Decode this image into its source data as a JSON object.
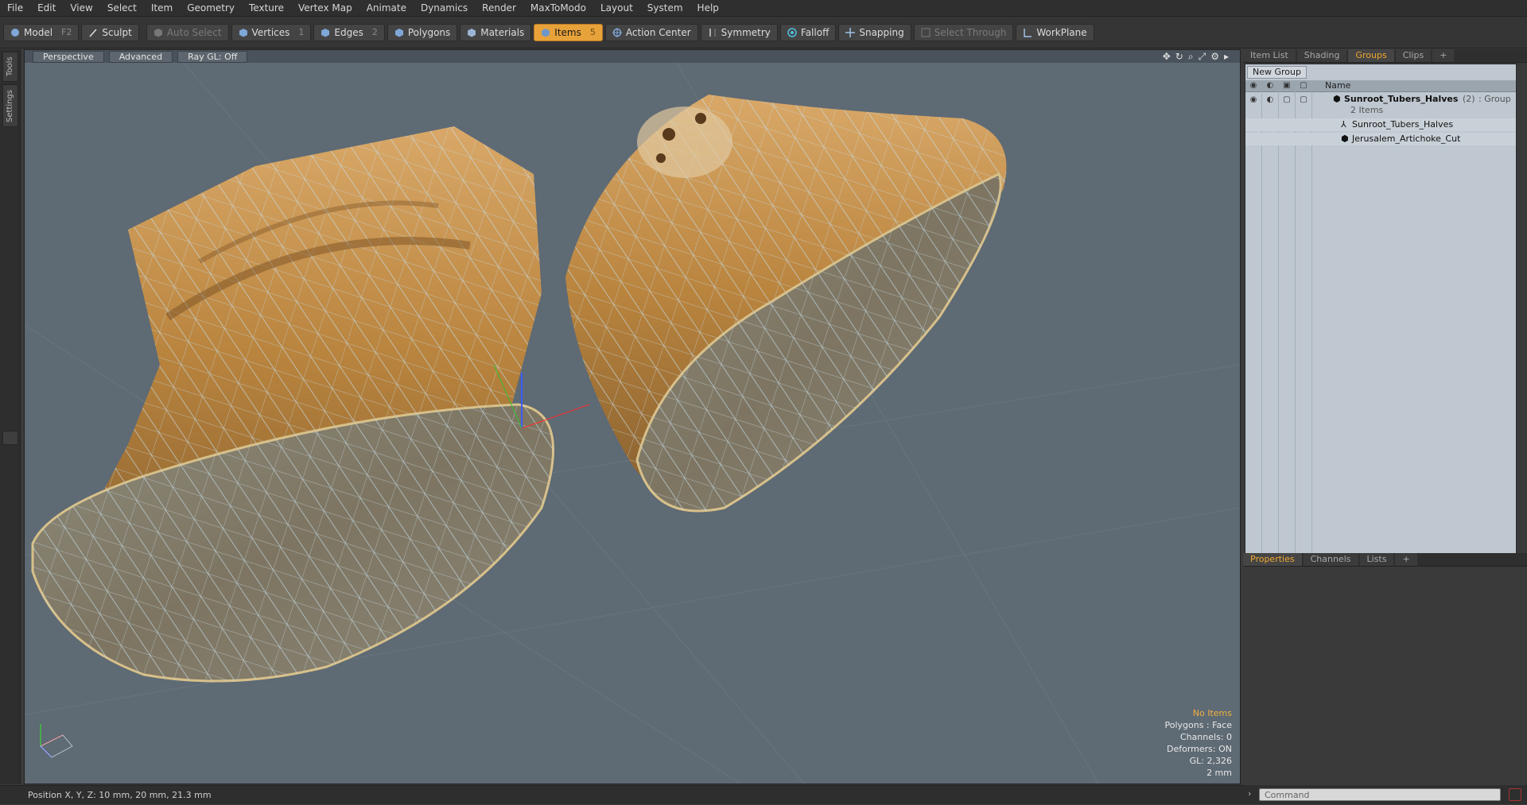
{
  "menu": [
    "File",
    "Edit",
    "View",
    "Select",
    "Item",
    "Geometry",
    "Texture",
    "Vertex Map",
    "Animate",
    "Dynamics",
    "Render",
    "MaxToModo",
    "Layout",
    "System",
    "Help"
  ],
  "toolbar": {
    "model": {
      "label": "Model",
      "key": "F2"
    },
    "sculpt": {
      "label": "Sculpt"
    },
    "auto_select": {
      "label": "Auto Select"
    },
    "vertices": {
      "label": "Vertices",
      "key": "1"
    },
    "edges": {
      "label": "Edges",
      "key": "2"
    },
    "polygons": {
      "label": "Polygons"
    },
    "materials": {
      "label": "Materials"
    },
    "items": {
      "label": "Items",
      "key": "5"
    },
    "action_center": {
      "label": "Action Center"
    },
    "symmetry": {
      "label": "Symmetry"
    },
    "falloff": {
      "label": "Falloff"
    },
    "snapping": {
      "label": "Snapping"
    },
    "select_through": {
      "label": "Select Through"
    },
    "workplane": {
      "label": "WorkPlane"
    },
    "accent_color": "#e8a23a"
  },
  "left_tabs": {
    "tools": "Tools",
    "settings": "Settings"
  },
  "viewport": {
    "perspective": "Perspective",
    "advanced": "Advanced",
    "raygl": "Ray GL: Off",
    "info": {
      "selection": "No Items",
      "polygons": "Polygons : Face",
      "channels": "Channels: 0",
      "deformers": "Deformers: ON",
      "gl": "GL: 2,326",
      "scale": "2 mm"
    },
    "bg_color": "#5e6a74"
  },
  "right_panel": {
    "tabs": [
      "Item List",
      "Shading",
      "Groups",
      "Clips"
    ],
    "active_tab": "Groups",
    "new_group": "New Group",
    "col_name": "Name",
    "group": {
      "name": "Sunroot_Tubers_Halves",
      "count": "(2)",
      "type": ": Group",
      "items_label": "2 Items"
    },
    "children": [
      "Sunroot_Tubers_Halves",
      "Jerusalem_Artichoke_Cut"
    ]
  },
  "props_panel": {
    "tabs": [
      "Properties",
      "Channels",
      "Lists"
    ],
    "active_tab": "Properties"
  },
  "status": {
    "position": "Position X, Y, Z:   10 mm, 20 mm, 21.3 mm"
  },
  "command": {
    "placeholder": "Command"
  }
}
